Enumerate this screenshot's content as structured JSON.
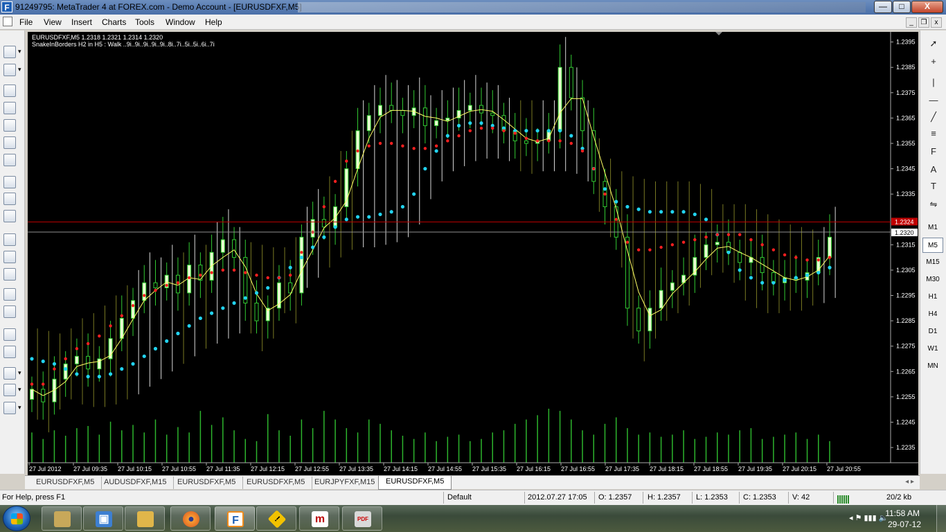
{
  "window": {
    "title": "91249795: MetaTrader 4 at FOREX.com - Demo Account - [EURUSDFXF,M5]",
    "minimize": "—",
    "maximize": "□",
    "close": "X",
    "app_icon": "F"
  },
  "menu": [
    "File",
    "View",
    "Insert",
    "Charts",
    "Tools",
    "Window",
    "Help"
  ],
  "mdi_controls": [
    "_",
    "❐",
    "x"
  ],
  "timeframes": [
    "M1",
    "M5",
    "M15",
    "M30",
    "H1",
    "H4",
    "D1",
    "W1",
    "MN"
  ],
  "right_tools_icons": [
    "cursor-icon",
    "crosshair-icon",
    "vertical-line-icon",
    "horizontal-line-icon",
    "trendline-icon",
    "channel-icon",
    "fibonacci-icon",
    "text-icon",
    "text-label-icon",
    "arrow-tool-icon"
  ],
  "right_tools_glyphs": {
    "cursor": "➚",
    "crosshair": "+",
    "vertical": "|",
    "horizontal": "—",
    "trend": "╱",
    "channel": "≡",
    "fib": "F",
    "text": "A",
    "label": "T",
    "arrow": "⇋"
  },
  "chart_header": {
    "line1": "EURUSDFXF,M5  1.2318 1.2321 1.2314 1.2320",
    "line2": "SnakeInBorders H2 in H5 :   Walk ..9i..9i..9i..9i..9i..8i..7i..5i..5i..6i..7i"
  },
  "price_labels": {
    "bid_line": "1.2320",
    "ask_line": "1.2324"
  },
  "chart_data": {
    "type": "candlestick",
    "symbol": "EURUSDFXF",
    "timeframe": "M5",
    "ylim": [
      1.2229,
      1.2399
    ],
    "y_ticks": [
      "1.2395",
      "1.2385",
      "1.2375",
      "1.2365",
      "1.2355",
      "1.2345",
      "1.2335",
      "1.2315",
      "1.2305",
      "1.2295",
      "1.2285",
      "1.2275",
      "1.2265",
      "1.2255",
      "1.2245",
      "1.2235"
    ],
    "y_tick_values": [
      1.2395,
      1.2385,
      1.2375,
      1.2365,
      1.2355,
      1.2345,
      1.2335,
      1.2315,
      1.2305,
      1.2295,
      1.2285,
      1.2275,
      1.2265,
      1.2255,
      1.2245,
      1.2235
    ],
    "x_ticks": [
      "27 Jul 2012",
      "27 Jul 09:35",
      "27 Jul 10:15",
      "27 Jul 10:55",
      "27 Jul 11:35",
      "27 Jul 12:15",
      "27 Jul 12:55",
      "27 Jul 13:35",
      "27 Jul 14:15",
      "27 Jul 14:55",
      "27 Jul 15:35",
      "27 Jul 16:15",
      "27 Jul 16:55",
      "27 Jul 17:35",
      "27 Jul 18:15",
      "27 Jul 18:55",
      "27 Jul 19:35",
      "27 Jul 20:15",
      "27 Jul 20:55"
    ],
    "bid": 1.232,
    "ask": 1.2324,
    "close_trend": [
      1.2258,
      1.2253,
      1.2262,
      1.2268,
      1.2271,
      1.2266,
      1.227,
      1.2278,
      1.2286,
      1.2293,
      1.23,
      1.2298,
      1.2303,
      1.2296,
      1.2307,
      1.2301,
      1.2312,
      1.2317,
      1.231,
      1.2292,
      1.2285,
      1.229,
      1.23,
      1.2296,
      1.2318,
      1.2325,
      1.2322,
      1.233,
      1.2345,
      1.236,
      1.2366,
      1.237,
      1.2368,
      1.2366,
      1.2369,
      1.2362,
      1.2364,
      1.2365,
      1.2368,
      1.237,
      1.2367,
      1.2366,
      1.236,
      1.2356,
      1.2355,
      1.2356,
      1.236,
      1.2385,
      1.2373,
      1.236,
      1.234,
      1.233,
      1.2318,
      1.229,
      1.2281,
      1.229,
      1.2297,
      1.23,
      1.2303,
      1.231,
      1.2315,
      1.2316,
      1.2312,
      1.2308,
      1.231,
      1.2304,
      1.23,
      1.2302,
      1.2301,
      1.2304,
      1.231,
      1.2318
    ],
    "upper_band": [
      1.226,
      1.226,
      1.2266,
      1.227,
      1.2274,
      1.2276,
      1.2279,
      1.2283,
      1.2287,
      1.2291,
      1.2295,
      1.2297,
      1.2299,
      1.23,
      1.2302,
      1.2303,
      1.2304,
      1.2305,
      1.2305,
      1.2304,
      1.2303,
      1.2302,
      1.2302,
      1.2303,
      1.2312,
      1.232,
      1.233,
      1.234,
      1.2348,
      1.2352,
      1.2354,
      1.2355,
      1.2355,
      1.2354,
      1.2353,
      1.2353,
      1.2354,
      1.2356,
      1.2358,
      1.236,
      1.2361,
      1.2361,
      1.236,
      1.2359,
      1.2357,
      1.2356,
      1.2356,
      1.2356,
      1.2355,
      1.2352,
      1.2345,
      1.2335,
      1.2325,
      1.2316,
      1.2313,
      1.2313,
      1.2314,
      1.2315,
      1.2316,
      1.2317,
      1.2318,
      1.2319,
      1.2319,
      1.2319,
      1.2317,
      1.2315,
      1.2313,
      1.2311,
      1.231,
      1.2309,
      1.2309,
      1.231
    ],
    "lower_band": [
      1.227,
      1.2269,
      1.2268,
      1.2266,
      1.2264,
      1.2263,
      1.2263,
      1.2264,
      1.2266,
      1.2268,
      1.2271,
      1.2274,
      1.2277,
      1.228,
      1.2283,
      1.2286,
      1.2288,
      1.229,
      1.2292,
      1.2294,
      1.2296,
      1.2298,
      1.2302,
      1.2306,
      1.231,
      1.2314,
      1.2318,
      1.2322,
      1.2325,
      1.2326,
      1.2326,
      1.2327,
      1.2328,
      1.233,
      1.2335,
      1.2345,
      1.2352,
      1.2358,
      1.2362,
      1.2363,
      1.2363,
      1.2362,
      1.2361,
      1.236,
      1.236,
      1.236,
      1.236,
      1.236,
      1.2358,
      1.2353,
      1.2345,
      1.2337,
      1.2332,
      1.233,
      1.2329,
      1.2328,
      1.2328,
      1.2328,
      1.2328,
      1.2327,
      1.2325,
      1.2319,
      1.2312,
      1.2305,
      1.2302,
      1.23,
      1.23,
      1.2301,
      1.2302,
      1.2303,
      1.2304,
      1.2306
    ],
    "volume": [
      28,
      22,
      30,
      25,
      32,
      34,
      26,
      38,
      30,
      35,
      28,
      40,
      26,
      33,
      28,
      48,
      35,
      42,
      30,
      22,
      20,
      45,
      30,
      25,
      40,
      32,
      48,
      40,
      32,
      28,
      40,
      36,
      30,
      25,
      22,
      28,
      20,
      24,
      26,
      20,
      22,
      28,
      30,
      36,
      40,
      44,
      50,
      48,
      40,
      30,
      26,
      36,
      42,
      32,
      26,
      28,
      24,
      26,
      30,
      22,
      24,
      28,
      26,
      30,
      32,
      22,
      24,
      26,
      28,
      22,
      26,
      20
    ]
  },
  "tabs": [
    "EURUSDFXF,M5",
    "AUDUSDFXF,M15",
    "EURUSDFXF,M5",
    "EURUSDFXF,M5",
    "EURJPYFXF,M15",
    "EURUSDFXF,M5"
  ],
  "tab_scroll": "◂ ▸",
  "status": {
    "help": "For Help, press F1",
    "profile": "Default",
    "datetime": "2012.07.27 17:05",
    "open": "O: 1.2357",
    "high": "H: 1.2357",
    "low": "L: 1.2353",
    "close": "C: 1.2353",
    "volume": "V: 42",
    "traffic": "20/2 kb"
  },
  "taskbar": {
    "apps": [
      "windows-explorer-icon",
      "terminal-icon",
      "file-manager-icon",
      "firefox-icon",
      "forex-metatrader-icon",
      "warning-app-icon",
      "media-icon",
      "pdf-icon"
    ],
    "app_glyphs": {
      "terminal": "▣",
      "firefox": "●",
      "forex": "F",
      "warning": "!",
      "media": "m",
      "pdf": "PDF"
    },
    "tray_icons": "◂  ⚑  ▮▮▮  🔈",
    "time": "11:58 AM",
    "date": "29-07-12"
  }
}
